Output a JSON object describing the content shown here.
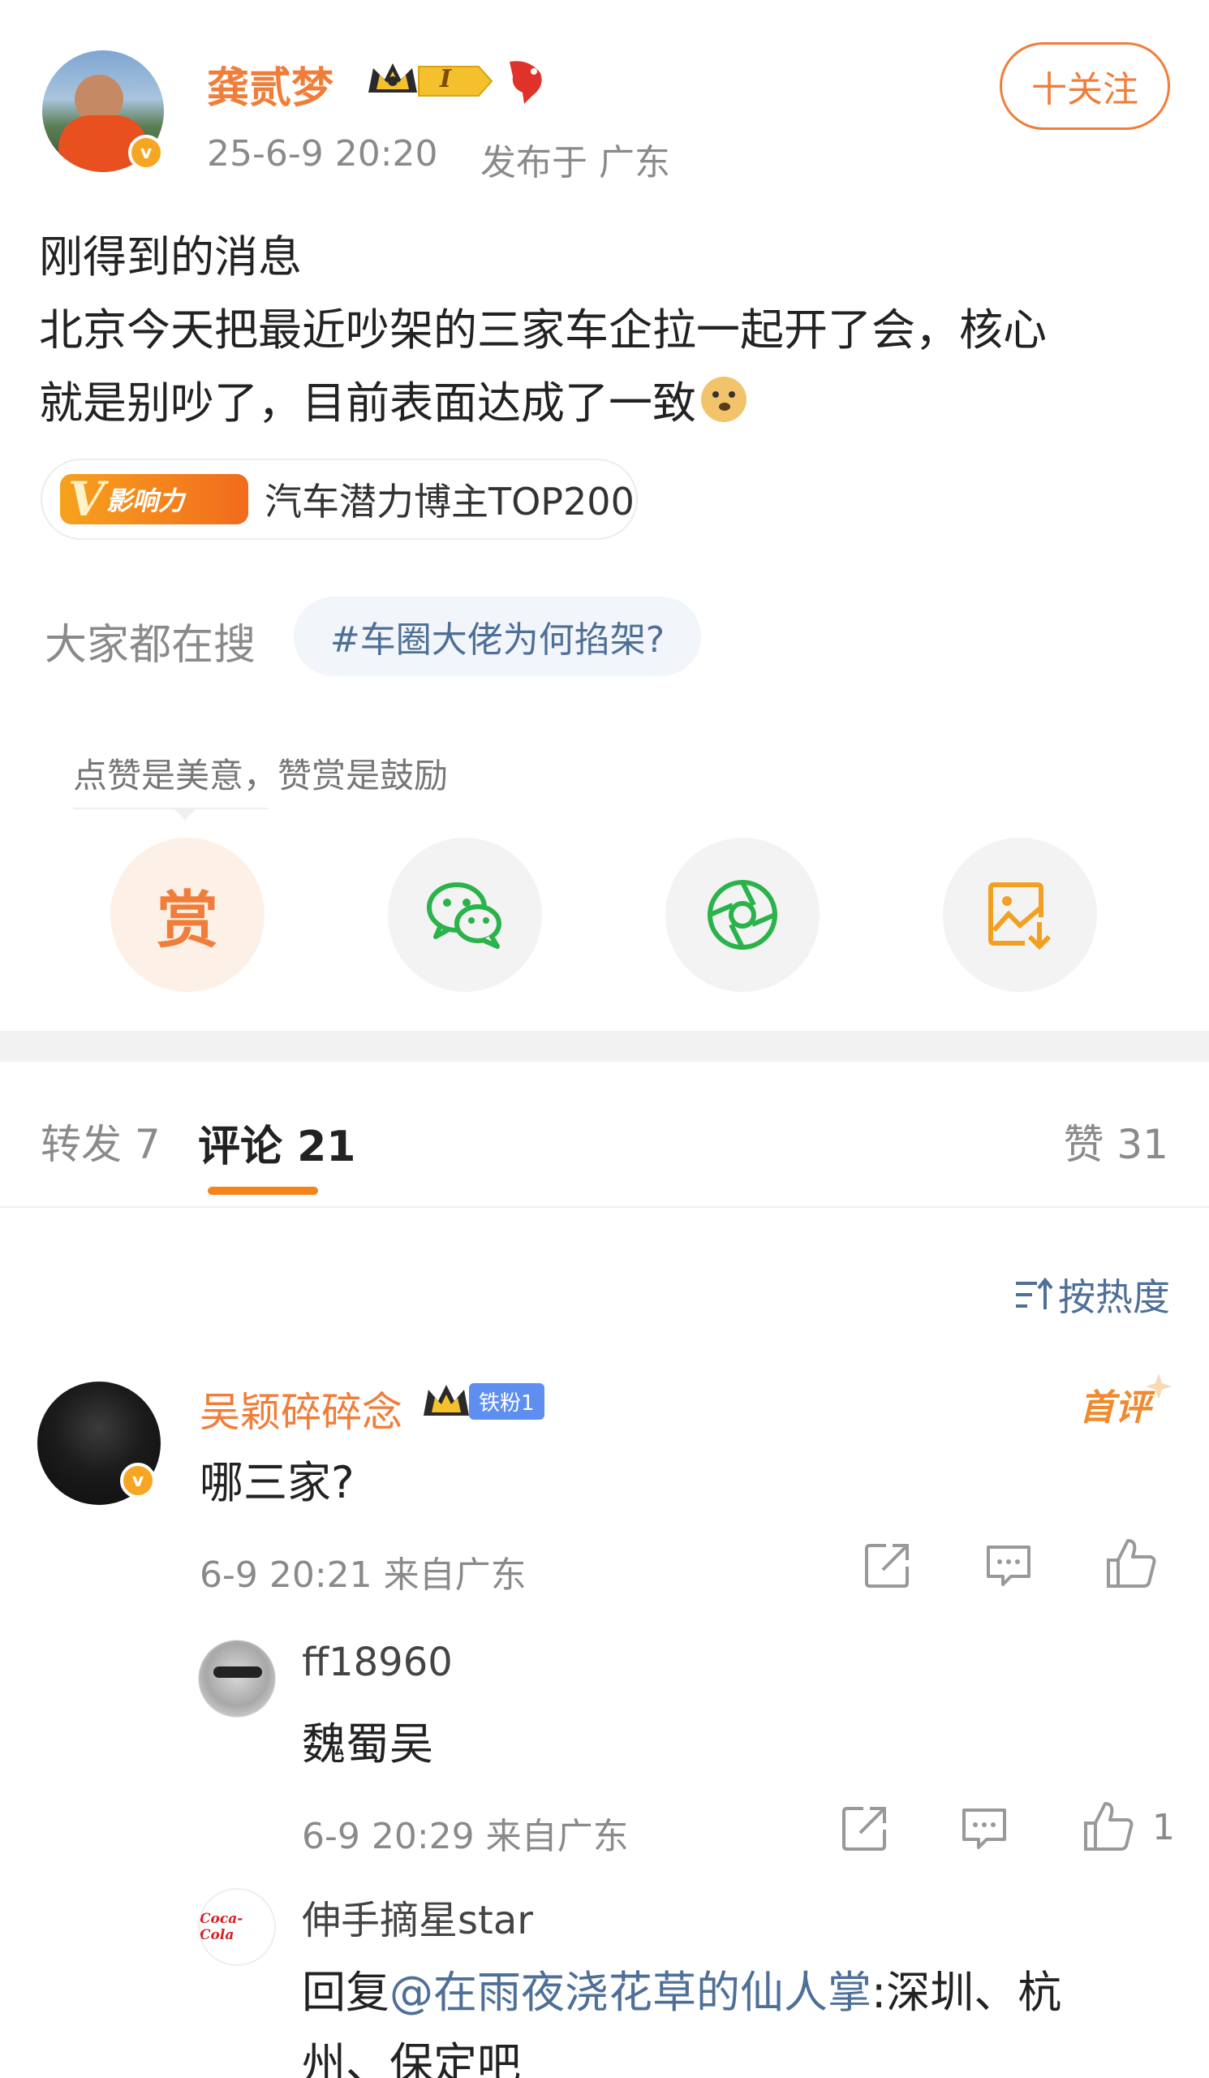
{
  "post": {
    "author": "龚贰梦",
    "level_badge": "I",
    "time": "25-6-9 20:20",
    "location": "发布于 广东",
    "follow_label": "十关注",
    "lines": [
      "刚得到的消息",
      "北京今天把最近吵架的三家车企拉一起开了会，核心",
      "就是别吵了，目前表面达成了一致"
    ],
    "influence_tag": "影响力",
    "influence_text": "汽车潜力博主TOP200"
  },
  "search": {
    "label": "大家都在搜",
    "topic": "#车圈大佬为何掐架?"
  },
  "reward": {
    "hint": "点赞是美意，赞赏是鼓励",
    "reward_char": "赏"
  },
  "tabs": {
    "repost": "转发 7",
    "comments": "评论 21",
    "likes": "赞 31"
  },
  "sort_label": "按热度",
  "comments": [
    {
      "user": "吴颖碎碎念",
      "fan_badge": "铁粉1",
      "first_badge": "首评",
      "text": "哪三家?",
      "meta": "6-9 20:21 来自广东",
      "replies": [
        {
          "user": "ff18960",
          "text": "魏蜀吴",
          "meta": "6-9 20:29 来自广东",
          "likes": "1"
        },
        {
          "user": "伸手摘星star",
          "avatar_text": "Coca-Cola",
          "reply_prefix": "回复",
          "mention": "@在雨夜浇花草的仙人掌",
          "text_rest": ":深圳、杭",
          "text_line2": "州、保定吧"
        }
      ]
    }
  ],
  "colors": {
    "orange": "#f07e3a",
    "link": "#4e6f97",
    "grey": "#8a8a8a",
    "wechat_green": "#2ab34a"
  }
}
